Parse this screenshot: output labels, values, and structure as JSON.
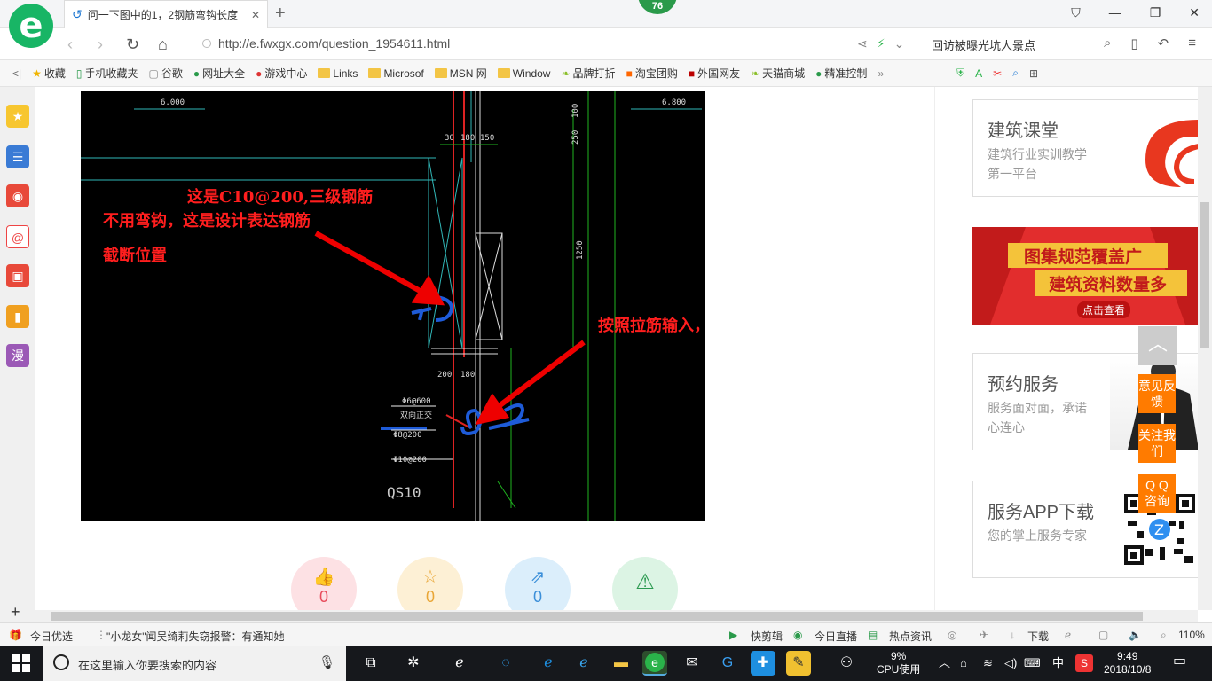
{
  "browser": {
    "tab_title": "问一下图中的1，2钢筋弯钩长度",
    "badge_count": "76",
    "url": "http://e.fwxgx.com/question_1954611.html",
    "hot_search": "回访被曝光坑人景点"
  },
  "bookmarks": [
    "收藏",
    "手机收藏夹",
    "谷歌",
    "网址大全",
    "游戏中心",
    "Links",
    "Microsof",
    "MSN 网",
    "Window",
    "品牌打折",
    "淘宝团购",
    "外国网友",
    "天猫商城",
    "精准控制"
  ],
  "sidebar": {
    "manga_label": "漫"
  },
  "cad": {
    "annotation1": "这是C10@200,三级钢筋",
    "annotation2": "不用弯钩，这是设计表达钢筋",
    "annotation3": "截断位置",
    "annotation4": "按照拉筋输入，软件自动计算的",
    "mark1": "1",
    "mark2": "2",
    "dims": [
      "6.000",
      "6.800",
      "30",
      "180",
      "150",
      "100",
      "250",
      "1250",
      "200",
      "180",
      "QS10",
      "Φ6@600",
      "双向正交",
      "Φ8@200",
      "Φ10@200"
    ]
  },
  "actions": [
    {
      "icon": "thumbs-up",
      "count": "0",
      "color": "#fde1e4",
      "fg": "#e84c5c"
    },
    {
      "icon": "star",
      "count": "0",
      "color": "#fdf0d5",
      "fg": "#e9a636"
    },
    {
      "icon": "share",
      "count": "0",
      "color": "#dbeefb",
      "fg": "#3b8fd9"
    },
    {
      "icon": "warning",
      "count": "",
      "color": "#dcf4e4",
      "fg": "#2b9a50"
    }
  ],
  "cards": [
    {
      "title": "建筑课堂",
      "desc": "建筑行业实训教学第一平台"
    },
    {
      "title": "预约服务",
      "desc": "服务面对面，承诺心连心"
    },
    {
      "title": "服务APP下载",
      "desc": "您的掌上服务专家"
    }
  ],
  "banner": {
    "line1": "图集规范覆盖广",
    "line2": "建筑资料数量多",
    "cta": "点击查看"
  },
  "float_buttons": [
    "意见反馈",
    "关注我们",
    "Q Q 咨询"
  ],
  "status": {
    "today": "今日优选",
    "news": "\"小龙女\"闻吴绮莉失窃报警：有通知她",
    "clip": "快剪辑",
    "live": "今日直播",
    "hot": "热点资讯",
    "download": "下载",
    "zoom": "110%"
  },
  "taskbar": {
    "search_placeholder": "在这里输入你要搜索的内容",
    "cpu_pct": "9%",
    "cpu_label": "CPU使用",
    "ime": "中",
    "time": "9:49",
    "date": "2018/10/8"
  }
}
